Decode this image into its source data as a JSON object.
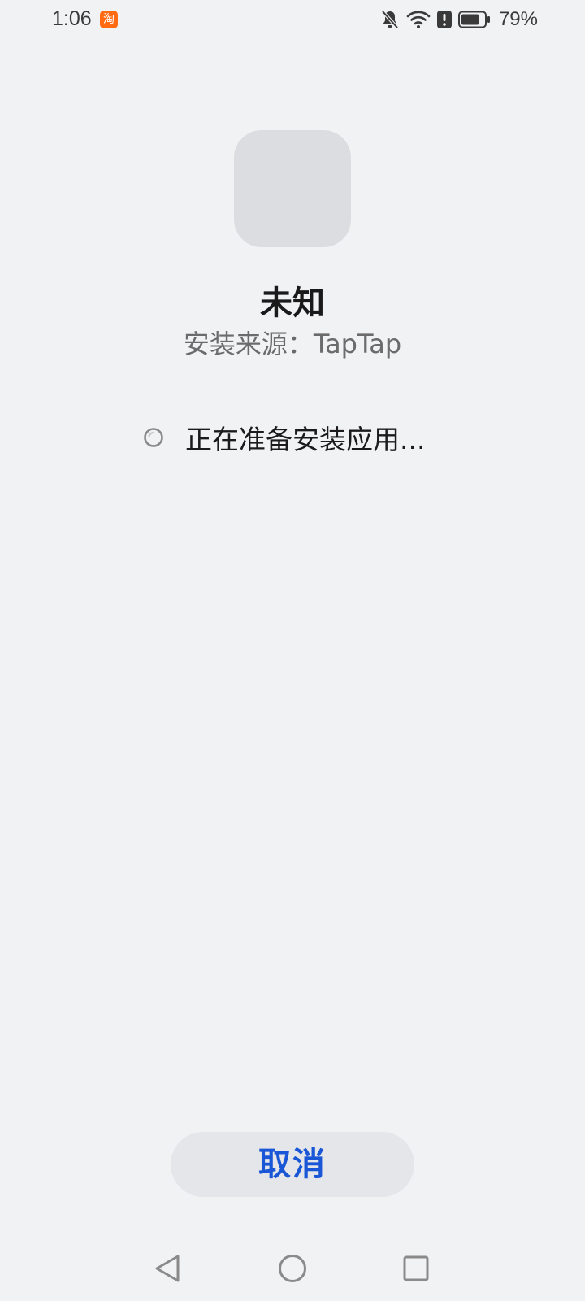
{
  "status_bar": {
    "time": "1:06",
    "notification_app_icon": "taobao-icon",
    "notification_app_glyph": "淘",
    "icons": [
      "bell-muted-icon",
      "wifi-icon",
      "alert-icon",
      "battery-icon"
    ],
    "battery_percent": "79%",
    "battery_level": 0.79
  },
  "app": {
    "name": "未知",
    "install_source": "安装来源：TapTap"
  },
  "progress": {
    "icon": "spinner-icon",
    "message": "正在准备安装应用..."
  },
  "actions": {
    "cancel_label": "取消",
    "accent_color": "#1a57d6"
  },
  "nav_bar": {
    "buttons": [
      "back-icon",
      "home-icon",
      "recent-apps-icon"
    ]
  }
}
